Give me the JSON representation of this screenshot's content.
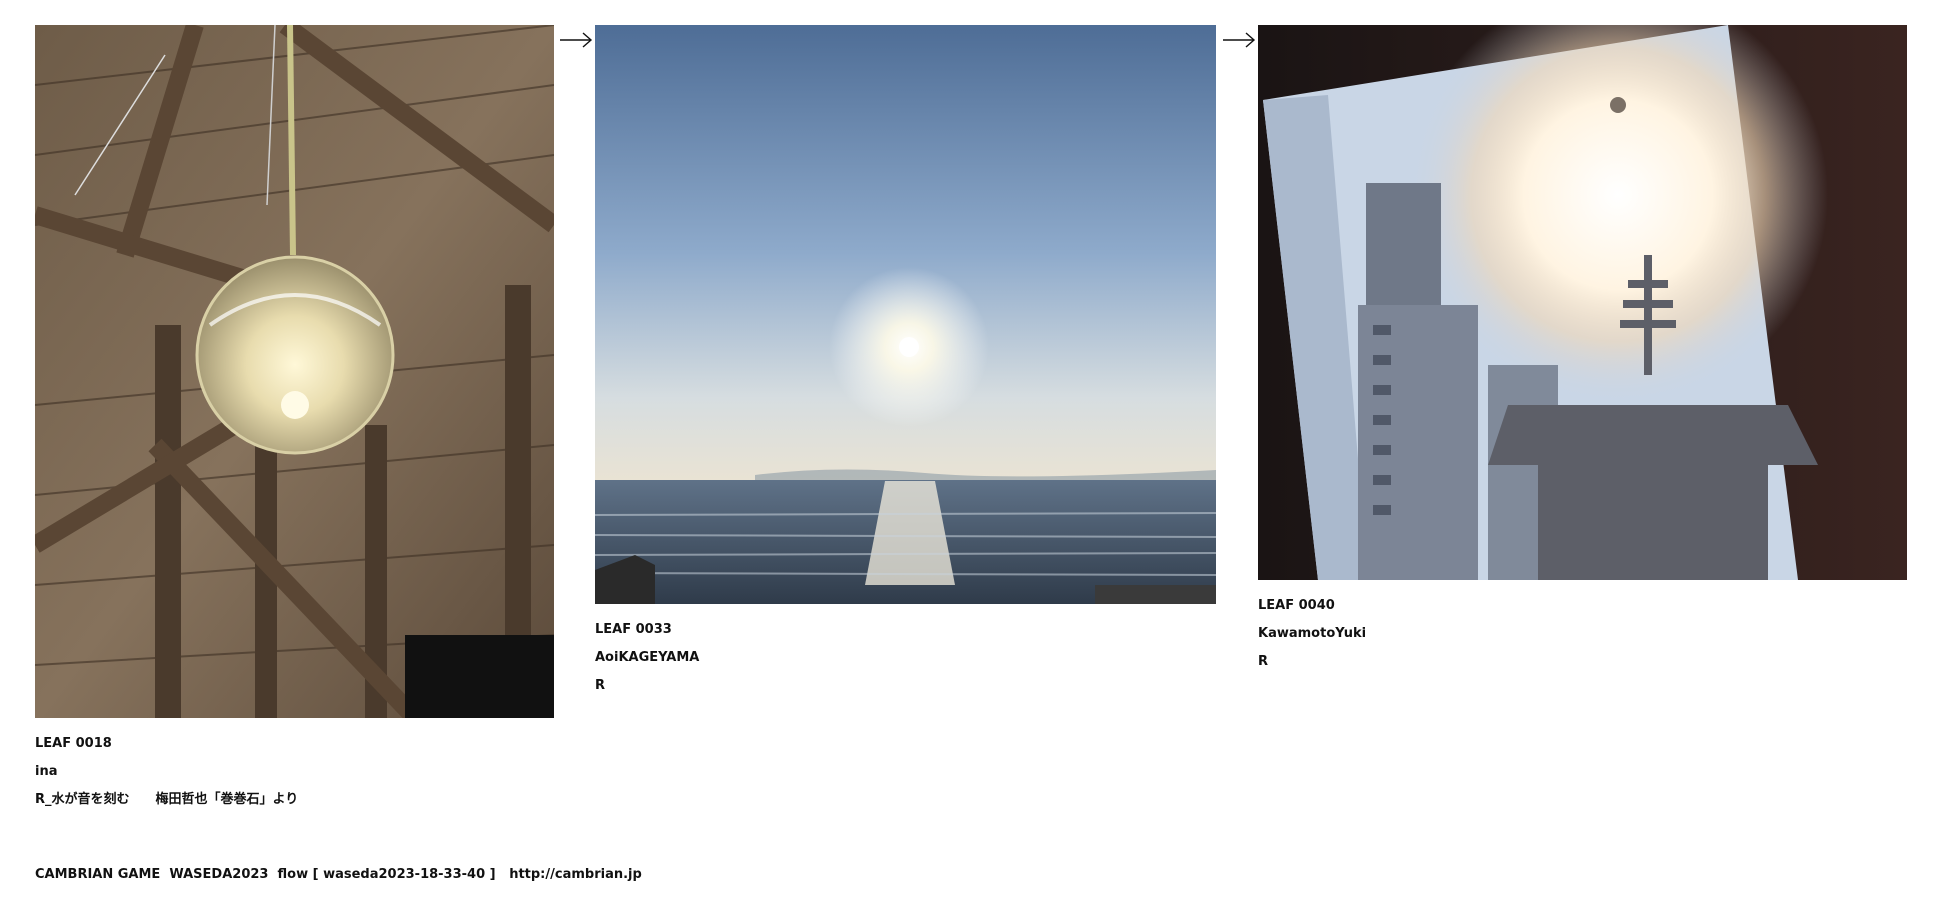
{
  "leaves": [
    {
      "id": "LEAF 0018",
      "author": "ina",
      "caption": "R_水が音を刻む　　梅田哲也「巻巻石」より",
      "image": "hanging glass globe lamp under wooden barn ceiling"
    },
    {
      "id": "LEAF 0033",
      "author": "AoiKAGEYAMA",
      "caption": "R",
      "image": "sun over the sea with surfers"
    },
    {
      "id": "LEAF 0040",
      "author": "KawamotoYuki",
      "caption": "R",
      "image": "sun glare over pagoda and building through glass"
    }
  ],
  "arrows": [
    "right-arrow-icon",
    "right-arrow-icon"
  ],
  "footer": {
    "text": "CAMBRIAN GAME  WASEDA2023  flow [ waseda2023-18-33-40 ]   ",
    "link": "http://cambrian.jp"
  }
}
